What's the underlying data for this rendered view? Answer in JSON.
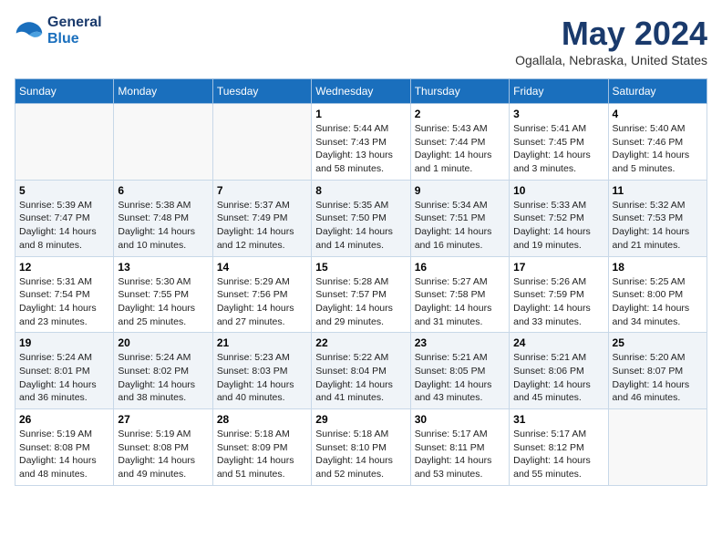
{
  "header": {
    "logo_line1": "General",
    "logo_line2": "Blue",
    "month_title": "May 2024",
    "location": "Ogallala, Nebraska, United States"
  },
  "weekdays": [
    "Sunday",
    "Monday",
    "Tuesday",
    "Wednesday",
    "Thursday",
    "Friday",
    "Saturday"
  ],
  "weeks": [
    [
      {
        "day": "",
        "sunrise": "",
        "sunset": "",
        "daylight": ""
      },
      {
        "day": "",
        "sunrise": "",
        "sunset": "",
        "daylight": ""
      },
      {
        "day": "",
        "sunrise": "",
        "sunset": "",
        "daylight": ""
      },
      {
        "day": "1",
        "sunrise": "Sunrise: 5:44 AM",
        "sunset": "Sunset: 7:43 PM",
        "daylight": "Daylight: 13 hours and 58 minutes."
      },
      {
        "day": "2",
        "sunrise": "Sunrise: 5:43 AM",
        "sunset": "Sunset: 7:44 PM",
        "daylight": "Daylight: 14 hours and 1 minute."
      },
      {
        "day": "3",
        "sunrise": "Sunrise: 5:41 AM",
        "sunset": "Sunset: 7:45 PM",
        "daylight": "Daylight: 14 hours and 3 minutes."
      },
      {
        "day": "4",
        "sunrise": "Sunrise: 5:40 AM",
        "sunset": "Sunset: 7:46 PM",
        "daylight": "Daylight: 14 hours and 5 minutes."
      }
    ],
    [
      {
        "day": "5",
        "sunrise": "Sunrise: 5:39 AM",
        "sunset": "Sunset: 7:47 PM",
        "daylight": "Daylight: 14 hours and 8 minutes."
      },
      {
        "day": "6",
        "sunrise": "Sunrise: 5:38 AM",
        "sunset": "Sunset: 7:48 PM",
        "daylight": "Daylight: 14 hours and 10 minutes."
      },
      {
        "day": "7",
        "sunrise": "Sunrise: 5:37 AM",
        "sunset": "Sunset: 7:49 PM",
        "daylight": "Daylight: 14 hours and 12 minutes."
      },
      {
        "day": "8",
        "sunrise": "Sunrise: 5:35 AM",
        "sunset": "Sunset: 7:50 PM",
        "daylight": "Daylight: 14 hours and 14 minutes."
      },
      {
        "day": "9",
        "sunrise": "Sunrise: 5:34 AM",
        "sunset": "Sunset: 7:51 PM",
        "daylight": "Daylight: 14 hours and 16 minutes."
      },
      {
        "day": "10",
        "sunrise": "Sunrise: 5:33 AM",
        "sunset": "Sunset: 7:52 PM",
        "daylight": "Daylight: 14 hours and 19 minutes."
      },
      {
        "day": "11",
        "sunrise": "Sunrise: 5:32 AM",
        "sunset": "Sunset: 7:53 PM",
        "daylight": "Daylight: 14 hours and 21 minutes."
      }
    ],
    [
      {
        "day": "12",
        "sunrise": "Sunrise: 5:31 AM",
        "sunset": "Sunset: 7:54 PM",
        "daylight": "Daylight: 14 hours and 23 minutes."
      },
      {
        "day": "13",
        "sunrise": "Sunrise: 5:30 AM",
        "sunset": "Sunset: 7:55 PM",
        "daylight": "Daylight: 14 hours and 25 minutes."
      },
      {
        "day": "14",
        "sunrise": "Sunrise: 5:29 AM",
        "sunset": "Sunset: 7:56 PM",
        "daylight": "Daylight: 14 hours and 27 minutes."
      },
      {
        "day": "15",
        "sunrise": "Sunrise: 5:28 AM",
        "sunset": "Sunset: 7:57 PM",
        "daylight": "Daylight: 14 hours and 29 minutes."
      },
      {
        "day": "16",
        "sunrise": "Sunrise: 5:27 AM",
        "sunset": "Sunset: 7:58 PM",
        "daylight": "Daylight: 14 hours and 31 minutes."
      },
      {
        "day": "17",
        "sunrise": "Sunrise: 5:26 AM",
        "sunset": "Sunset: 7:59 PM",
        "daylight": "Daylight: 14 hours and 33 minutes."
      },
      {
        "day": "18",
        "sunrise": "Sunrise: 5:25 AM",
        "sunset": "Sunset: 8:00 PM",
        "daylight": "Daylight: 14 hours and 34 minutes."
      }
    ],
    [
      {
        "day": "19",
        "sunrise": "Sunrise: 5:24 AM",
        "sunset": "Sunset: 8:01 PM",
        "daylight": "Daylight: 14 hours and 36 minutes."
      },
      {
        "day": "20",
        "sunrise": "Sunrise: 5:24 AM",
        "sunset": "Sunset: 8:02 PM",
        "daylight": "Daylight: 14 hours and 38 minutes."
      },
      {
        "day": "21",
        "sunrise": "Sunrise: 5:23 AM",
        "sunset": "Sunset: 8:03 PM",
        "daylight": "Daylight: 14 hours and 40 minutes."
      },
      {
        "day": "22",
        "sunrise": "Sunrise: 5:22 AM",
        "sunset": "Sunset: 8:04 PM",
        "daylight": "Daylight: 14 hours and 41 minutes."
      },
      {
        "day": "23",
        "sunrise": "Sunrise: 5:21 AM",
        "sunset": "Sunset: 8:05 PM",
        "daylight": "Daylight: 14 hours and 43 minutes."
      },
      {
        "day": "24",
        "sunrise": "Sunrise: 5:21 AM",
        "sunset": "Sunset: 8:06 PM",
        "daylight": "Daylight: 14 hours and 45 minutes."
      },
      {
        "day": "25",
        "sunrise": "Sunrise: 5:20 AM",
        "sunset": "Sunset: 8:07 PM",
        "daylight": "Daylight: 14 hours and 46 minutes."
      }
    ],
    [
      {
        "day": "26",
        "sunrise": "Sunrise: 5:19 AM",
        "sunset": "Sunset: 8:08 PM",
        "daylight": "Daylight: 14 hours and 48 minutes."
      },
      {
        "day": "27",
        "sunrise": "Sunrise: 5:19 AM",
        "sunset": "Sunset: 8:08 PM",
        "daylight": "Daylight: 14 hours and 49 minutes."
      },
      {
        "day": "28",
        "sunrise": "Sunrise: 5:18 AM",
        "sunset": "Sunset: 8:09 PM",
        "daylight": "Daylight: 14 hours and 51 minutes."
      },
      {
        "day": "29",
        "sunrise": "Sunrise: 5:18 AM",
        "sunset": "Sunset: 8:10 PM",
        "daylight": "Daylight: 14 hours and 52 minutes."
      },
      {
        "day": "30",
        "sunrise": "Sunrise: 5:17 AM",
        "sunset": "Sunset: 8:11 PM",
        "daylight": "Daylight: 14 hours and 53 minutes."
      },
      {
        "day": "31",
        "sunrise": "Sunrise: 5:17 AM",
        "sunset": "Sunset: 8:12 PM",
        "daylight": "Daylight: 14 hours and 55 minutes."
      },
      {
        "day": "",
        "sunrise": "",
        "sunset": "",
        "daylight": ""
      }
    ]
  ]
}
